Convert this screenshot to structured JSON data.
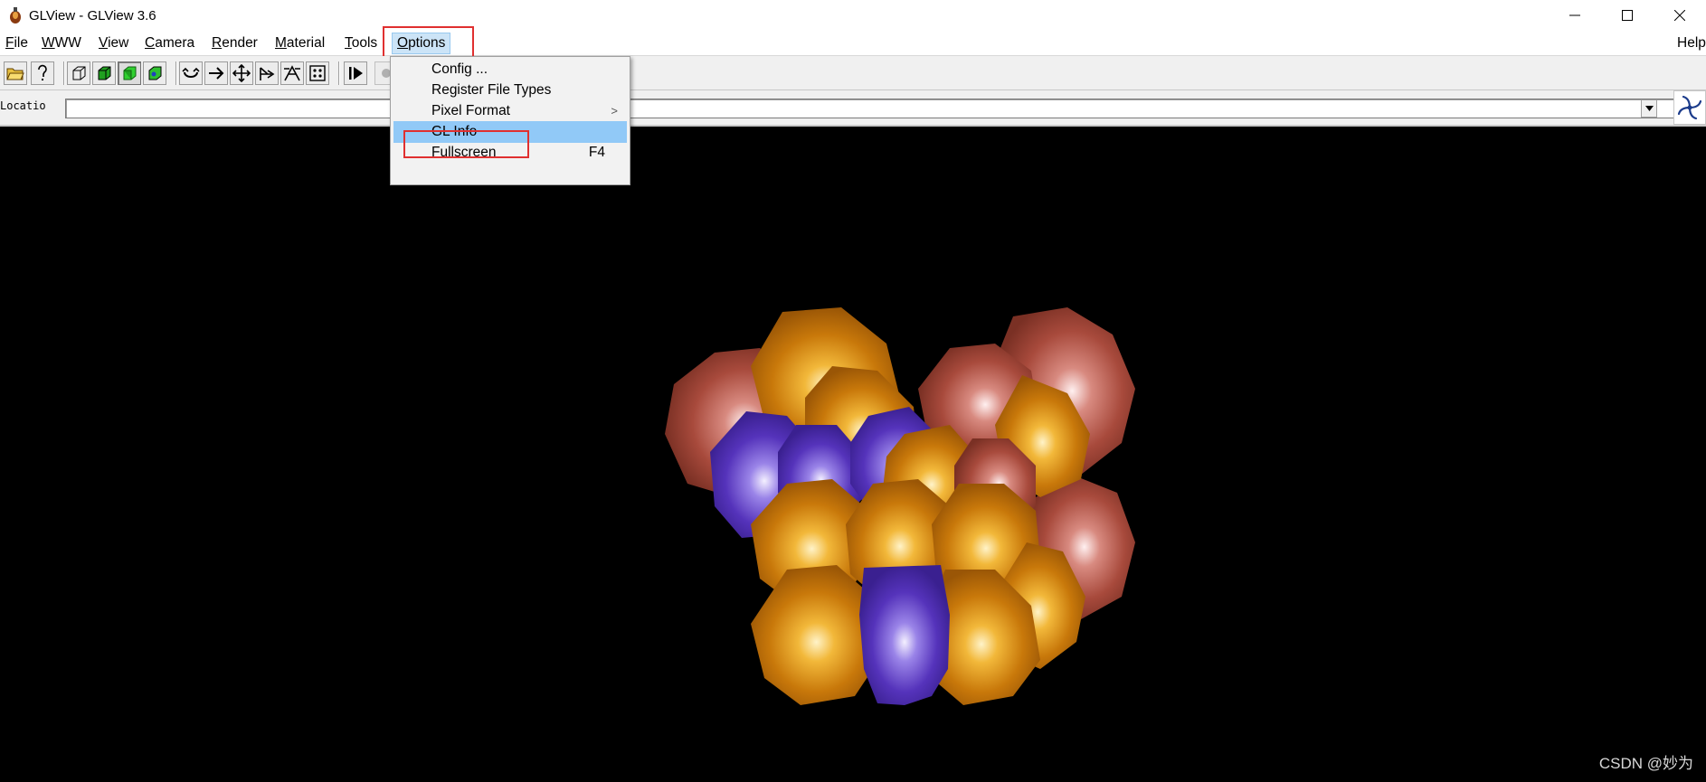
{
  "window": {
    "title": "GLView - GLView 3.6",
    "app_icon": "glview-app-icon",
    "controls": [
      "minimize-icon",
      "maximize-icon",
      "close-icon"
    ]
  },
  "menubar": {
    "items": [
      {
        "label": "File",
        "mnemonic": "F",
        "rest": "ile"
      },
      {
        "label": "WWW",
        "mnemonic": "W",
        "rest": "WW"
      },
      {
        "label": "View",
        "mnemonic": "V",
        "rest": "iew"
      },
      {
        "label": "Camera",
        "mnemonic": "C",
        "rest": "amera"
      },
      {
        "label": "Render",
        "mnemonic": "R",
        "rest": "ender"
      },
      {
        "label": "Material",
        "mnemonic": "M",
        "rest": "aterial"
      },
      {
        "label": "Tools",
        "mnemonic": "T",
        "rest": "ools"
      },
      {
        "label": "Options",
        "mnemonic": "O",
        "rest": "ptions",
        "active": true
      }
    ],
    "help": "Help"
  },
  "toolbar": {
    "buttons": [
      "open-folder-icon",
      "info-icon",
      "wireframe-cube-icon",
      "solid-cube-icon",
      "green-cube-icon",
      "textured-cube-icon",
      "rotate-icon",
      "move-right-icon",
      "pan-icon",
      "fly-icon",
      "walk-icon",
      "fit-view-icon",
      "play-icon"
    ]
  },
  "location": {
    "label": "Locatio",
    "value": ""
  },
  "options_menu": {
    "items": [
      {
        "label": "Config ...",
        "shortcut": "",
        "submenu": false
      },
      {
        "label": "Register File Types",
        "shortcut": "",
        "submenu": false
      },
      {
        "label": "Pixel Format",
        "shortcut": "",
        "submenu": true
      },
      {
        "label": "GL Info",
        "shortcut": "",
        "submenu": false,
        "highlighted": true
      },
      {
        "label": "Fullscreen",
        "shortcut": "F4",
        "submenu": false
      }
    ],
    "submenu_arrow": ">"
  },
  "colors": {
    "highlight": "#91c9f7",
    "active_menu": "#cce4f7",
    "annotation_box": "#e03030",
    "atom_orange": "#c8780a",
    "atom_blue": "#5533bb",
    "atom_red": "#a84a3c"
  },
  "watermark": "CSDN @妙为"
}
